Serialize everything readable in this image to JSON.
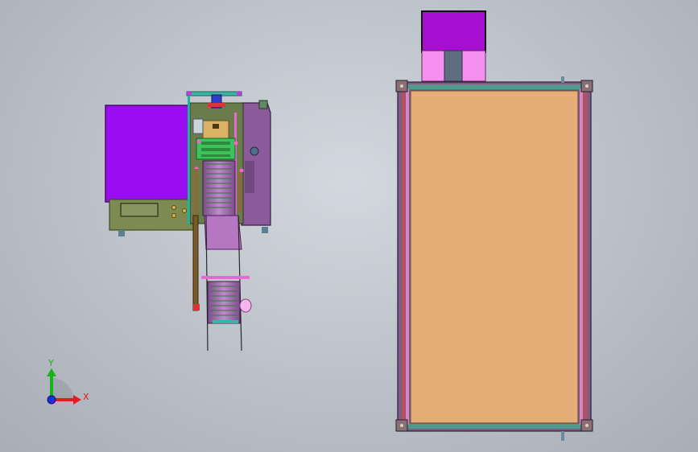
{
  "viewport": {
    "background_top": "#d3d7de",
    "background_bottom": "#a9aeb6"
  },
  "triad": {
    "y_label": "Y",
    "x_label": "X",
    "y_color": "#18b318",
    "x_color": "#e02020",
    "z_color": "#1a2fe0"
  },
  "colors": {
    "panel_purple": "#9a0df0",
    "plate_lavender": "#8b5a9a",
    "frame_olive": "#7d8a52",
    "table_top": "#e5ad77",
    "motor_magenta": "#a60fcf",
    "coupling_pink": "#f58ff0",
    "mechanism_green": "#3ec25a"
  }
}
